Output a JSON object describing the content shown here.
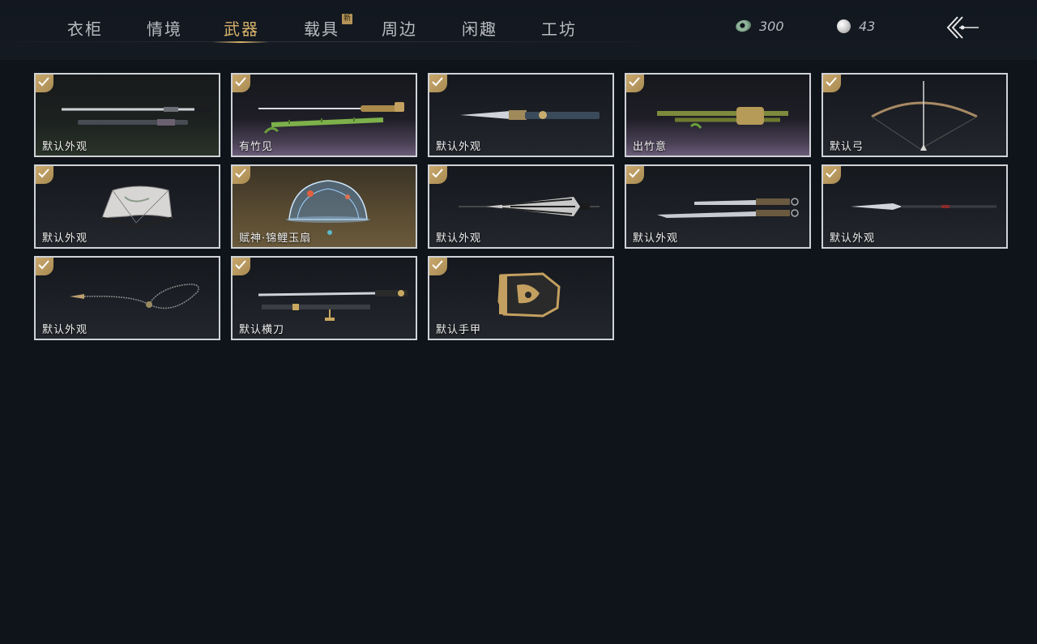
{
  "tabs": [
    {
      "label": "衣柜",
      "active": false
    },
    {
      "label": "情境",
      "active": false
    },
    {
      "label": "武器",
      "active": true
    },
    {
      "label": "载具",
      "active": false,
      "badge": "新"
    },
    {
      "label": "周边",
      "active": false
    },
    {
      "label": "闲趣",
      "active": false
    },
    {
      "label": "工坊",
      "active": false
    }
  ],
  "currency": {
    "jade": {
      "icon": "jade-coin-icon",
      "amount": "300"
    },
    "pearl": {
      "icon": "pearl-icon",
      "amount": "43"
    }
  },
  "back_icon": "back-arrow-icon",
  "colors": {
    "accent": "#d8b26a",
    "check": "#b59457",
    "card_border": "#cfd2d6"
  },
  "weapons": [
    {
      "label": "默认外观",
      "icon": "sword-pair-icon",
      "checked": true
    },
    {
      "label": "有竹见",
      "icon": "bamboo-sword-icon",
      "checked": true
    },
    {
      "label": "默认外观",
      "icon": "dagger-icon",
      "checked": true
    },
    {
      "label": "出竹意",
      "icon": "bamboo-staff-icon",
      "checked": true
    },
    {
      "label": "默认弓",
      "icon": "bow-icon",
      "checked": true
    },
    {
      "label": "默认外观",
      "icon": "folding-fan-icon",
      "checked": true
    },
    {
      "label": "赋神·锦鲤玉扇",
      "icon": "koi-jade-fan-icon",
      "checked": true
    },
    {
      "label": "默认外观",
      "icon": "closed-umbrella-icon",
      "checked": true
    },
    {
      "label": "默认外观",
      "icon": "twin-blades-icon",
      "checked": true
    },
    {
      "label": "默认外观",
      "icon": "long-spear-icon",
      "checked": true
    },
    {
      "label": "默认外观",
      "icon": "rope-dart-icon",
      "checked": true
    },
    {
      "label": "默认横刀",
      "icon": "hengdao-icon",
      "checked": true
    },
    {
      "label": "默认手甲",
      "icon": "gauntlet-icon",
      "checked": true
    }
  ]
}
